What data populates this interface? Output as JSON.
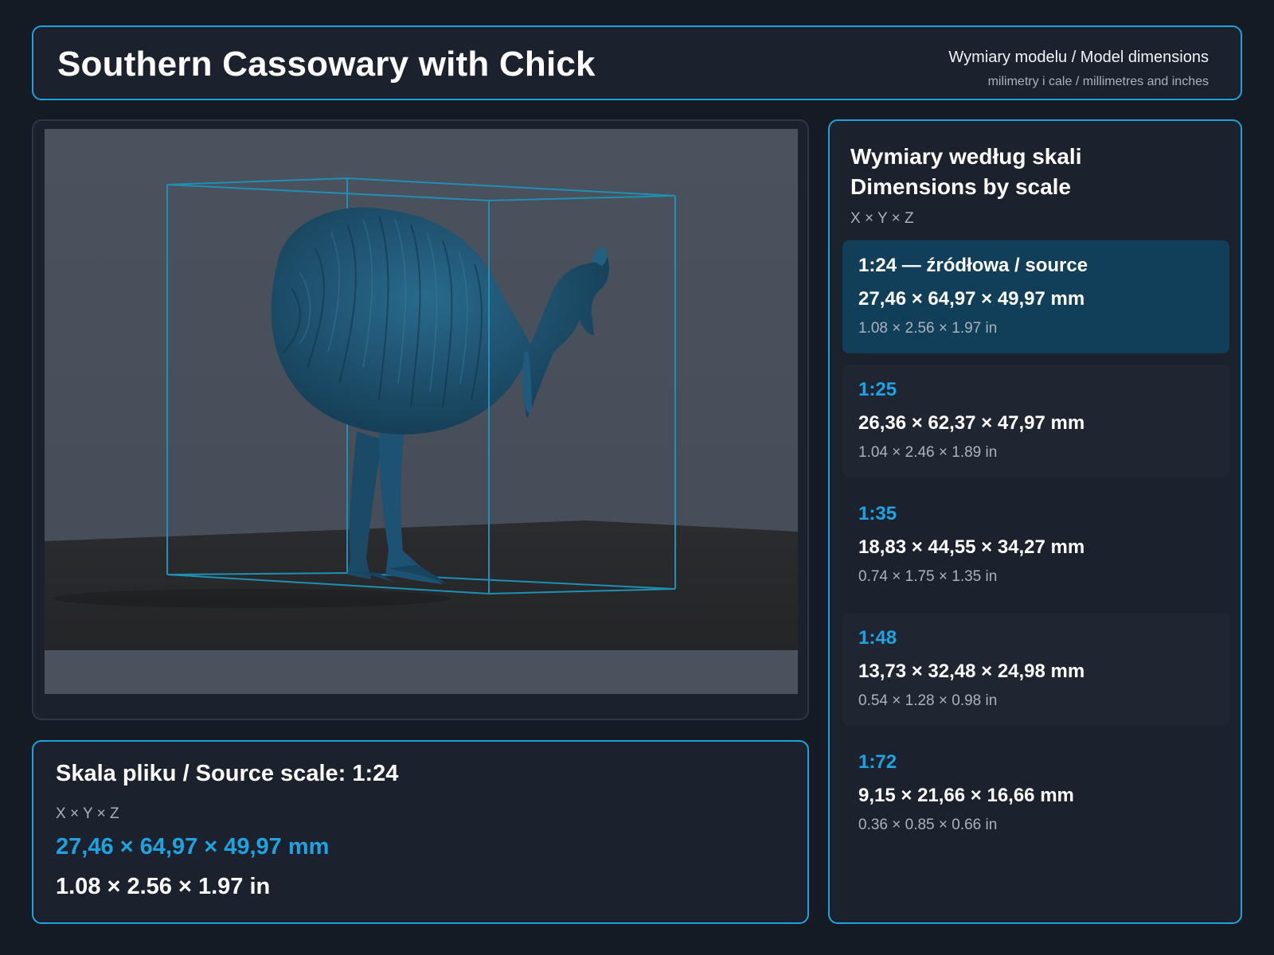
{
  "header": {
    "title": "Southern Cassowary with Chick",
    "subtitle": "Wymiary modelu / Model dimensions",
    "units_note": "milimetry i cale / millimetres and inches"
  },
  "source": {
    "heading": "Skala pliku / Source scale: 1:24",
    "axes": "X × Y × Z",
    "mm": "27,46 × 64,97 × 49,97 mm",
    "inch": "1.08 × 2.56 × 1.97 in"
  },
  "scales": {
    "heading_pl": "Wymiary według skali",
    "heading_en": "Dimensions by scale",
    "axes": "X × Y × Z",
    "items": [
      {
        "label": "1:24  —  źródłowa / source",
        "mm": "27,46 × 64,97 × 49,97 mm",
        "inch": "1.08 × 2.56 × 1.97 in"
      },
      {
        "label": "1:25",
        "mm": "26,36 × 62,37 × 47,97 mm",
        "inch": "1.04 × 2.46 × 1.89 in"
      },
      {
        "label": "1:35",
        "mm": "18,83 × 44,55 × 34,27 mm",
        "inch": "0.74 × 1.75 × 1.35 in"
      },
      {
        "label": "1:48",
        "mm": "13,73 × 32,48 × 24,98 mm",
        "inch": "0.54 × 1.28 × 0.98 in"
      },
      {
        "label": "1:72",
        "mm": "9,15 × 21,66 × 16,66 mm",
        "inch": "0.36 × 0.85 × 0.66 in"
      }
    ]
  },
  "colors": {
    "accent": "#1fa3e0",
    "background": "#141b25",
    "panel": "#1b222d",
    "active_card": "#113f5a",
    "model": "#1d4e6c"
  }
}
